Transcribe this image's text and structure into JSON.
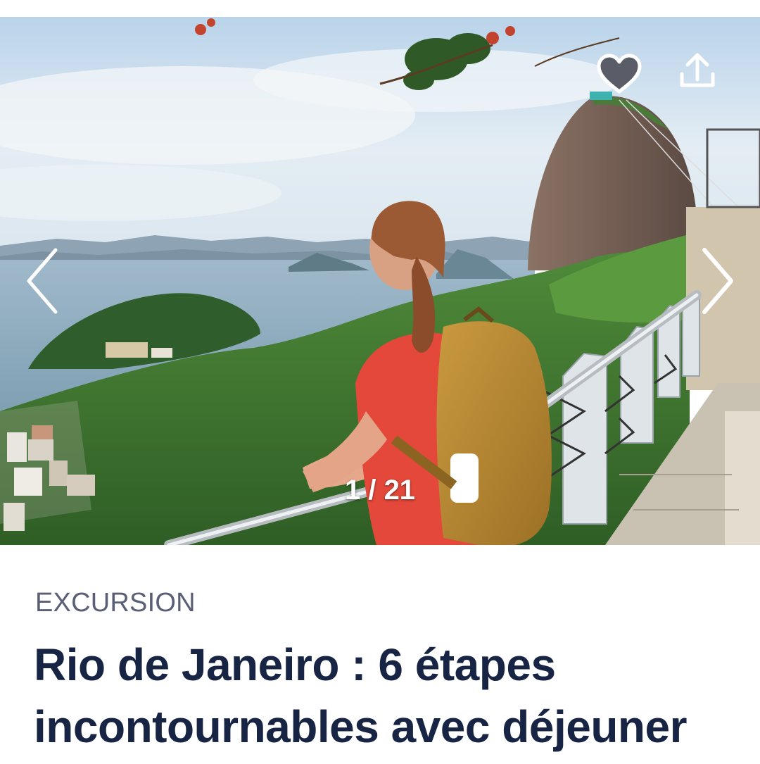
{
  "gallery": {
    "counter_current": "1",
    "counter_separator": "/",
    "counter_total": "21",
    "image_alt": "Femme avec sac à dos regardant la baie de Rio de Janeiro et le Pain de Sucre"
  },
  "actions": {
    "favorite_icon": "heart-icon",
    "share_icon": "share-upload-icon",
    "prev_icon": "chevron-left-icon",
    "next_icon": "chevron-right-icon"
  },
  "article": {
    "category": "EXCURSION",
    "title_line1": "Rio de Janeiro : 6 étapes",
    "title_line2": "incontournables avec déjeuner"
  },
  "colors": {
    "title": "#182444",
    "category": "#5b5f75",
    "overlay_icons": "#ffffff"
  }
}
